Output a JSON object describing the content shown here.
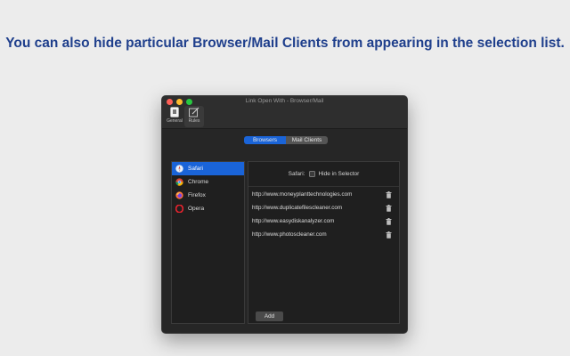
{
  "headline": "You can also hide particular Browser/Mail Clients from appearing in the selection list.",
  "window": {
    "title": "Link Open With - Browser/Mail",
    "toolbar": {
      "general_label": "General",
      "rules_label": "Rules"
    }
  },
  "segmented": {
    "browsers": "Browsers",
    "mail_clients": "Mail Clients",
    "selected": "Browsers"
  },
  "browsers": [
    {
      "label": "Safari",
      "icon": "safari-icon",
      "selected": true
    },
    {
      "label": "Chrome",
      "icon": "chrome-icon",
      "selected": false
    },
    {
      "label": "Firefox",
      "icon": "firefox-icon",
      "selected": false
    },
    {
      "label": "Opera",
      "icon": "opera-icon",
      "selected": false
    }
  ],
  "detail": {
    "browser_name": "Safari:",
    "hide_label": "Hide in Selector",
    "hide_checked": false,
    "urls": [
      "http://www.moneyplanttechnologies.com",
      "http://www.duplicatefilescleaner.com",
      "http://www.easydiskanalyzer.com",
      "http://www.photoscleaner.com"
    ],
    "add_label": "Add"
  },
  "colors": {
    "headline": "#1f3f8c",
    "accent": "#1a64d8",
    "window_bg": "#262626",
    "page_bg": "#ececec"
  }
}
